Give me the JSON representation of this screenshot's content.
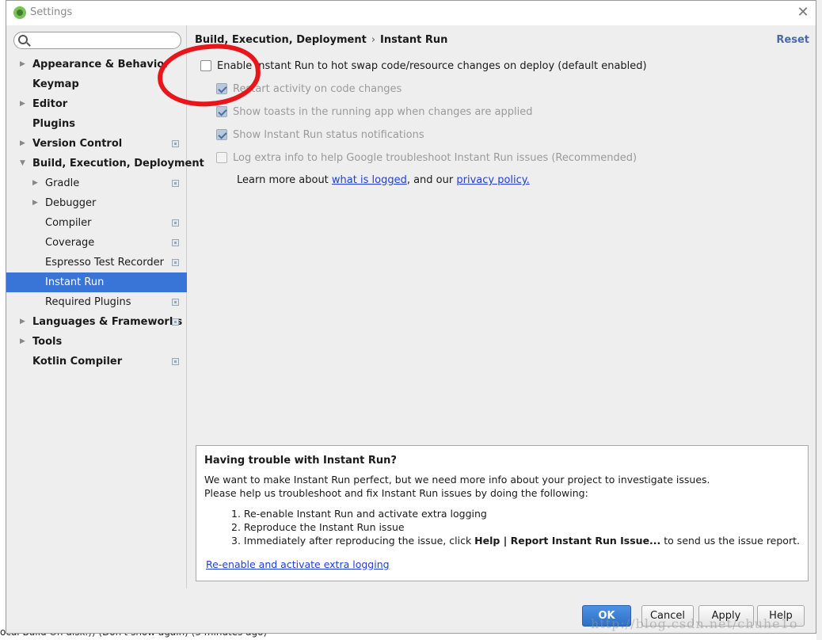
{
  "window": {
    "title": "Settings",
    "close_glyph": "✕"
  },
  "search": {
    "value": "",
    "placeholder": ""
  },
  "tree": [
    {
      "label": "Appearance & Behavior",
      "bold": true,
      "arrow": "right",
      "indent": 0,
      "proj": false
    },
    {
      "label": "Keymap",
      "bold": true,
      "arrow": "none",
      "indent": 0,
      "proj": false
    },
    {
      "label": "Editor",
      "bold": true,
      "arrow": "right",
      "indent": 0,
      "proj": false
    },
    {
      "label": "Plugins",
      "bold": true,
      "arrow": "none",
      "indent": 0,
      "proj": false
    },
    {
      "label": "Version Control",
      "bold": true,
      "arrow": "right",
      "indent": 0,
      "proj": true
    },
    {
      "label": "Build, Execution, Deployment",
      "bold": true,
      "arrow": "down",
      "indent": 0,
      "proj": false
    },
    {
      "label": "Gradle",
      "bold": false,
      "arrow": "right",
      "indent": 1,
      "proj": true
    },
    {
      "label": "Debugger",
      "bold": false,
      "arrow": "right",
      "indent": 1,
      "proj": false
    },
    {
      "label": "Compiler",
      "bold": false,
      "arrow": "none",
      "indent": 1,
      "proj": true
    },
    {
      "label": "Coverage",
      "bold": false,
      "arrow": "none",
      "indent": 1,
      "proj": true
    },
    {
      "label": "Espresso Test Recorder",
      "bold": false,
      "arrow": "none",
      "indent": 1,
      "proj": true
    },
    {
      "label": "Instant Run",
      "bold": false,
      "arrow": "none",
      "indent": 1,
      "proj": false,
      "selected": true
    },
    {
      "label": "Required Plugins",
      "bold": false,
      "arrow": "none",
      "indent": 1,
      "proj": true
    },
    {
      "label": "Languages & Frameworks",
      "bold": true,
      "arrow": "right",
      "indent": 0,
      "proj": true
    },
    {
      "label": "Tools",
      "bold": true,
      "arrow": "right",
      "indent": 0,
      "proj": false
    },
    {
      "label": "Kotlin Compiler",
      "bold": true,
      "arrow": "none",
      "indent": 0,
      "proj": true
    }
  ],
  "breadcrumb": {
    "parent": "Build, Execution, Deployment",
    "separator": "›",
    "current": "Instant Run"
  },
  "reset_label": "Reset",
  "options": {
    "enable": {
      "label": "Enable Instant Run to hot swap code/resource changes on deploy (default enabled)",
      "checked": false,
      "enabled": true
    },
    "restart": {
      "label": "Restart activity on code changes",
      "checked": true,
      "enabled": false
    },
    "toasts": {
      "label": "Show toasts in the running app when changes are applied",
      "checked": true,
      "enabled": false
    },
    "status": {
      "label": "Show Instant Run status notifications",
      "checked": true,
      "enabled": false
    },
    "log": {
      "label": "Log extra info to help Google troubleshoot Instant Run issues (Recommended)",
      "checked": false,
      "enabled": false
    }
  },
  "learn": {
    "prefix": "Learn more about ",
    "link1": "what is logged",
    "middle": ", and our ",
    "link2": "privacy policy."
  },
  "info": {
    "title": "Having trouble with Instant Run?",
    "line1": "We want to make Instant Run perfect, but we need more info about your project to investigate issues.",
    "line2": "Please help us troubleshoot and fix Instant Run issues by doing the following:",
    "step1": "1. Re-enable Instant Run and activate extra logging",
    "step2": "2. Reproduce the Instant Run issue",
    "step3_prefix": "3. Immediately after reproducing the issue, click ",
    "step3_bold": "Help | Report Instant Run Issue...",
    "step3_suffix": " to send us the issue report.",
    "link": "Re-enable and activate extra logging"
  },
  "buttons": {
    "ok": "OK",
    "cancel": "Cancel",
    "apply": "Apply",
    "help": "Help"
  },
  "background": {
    "status_text": "ocal Build On disk.)) (Don't show again) (3 minutes ago)",
    "watermark": "http://blog.csdn.net/chuhe1o"
  },
  "colors": {
    "selection": "#3875d6",
    "link": "#1f3fd6",
    "primary_button": "#3a7fd9",
    "annotation": "#e8161b"
  }
}
